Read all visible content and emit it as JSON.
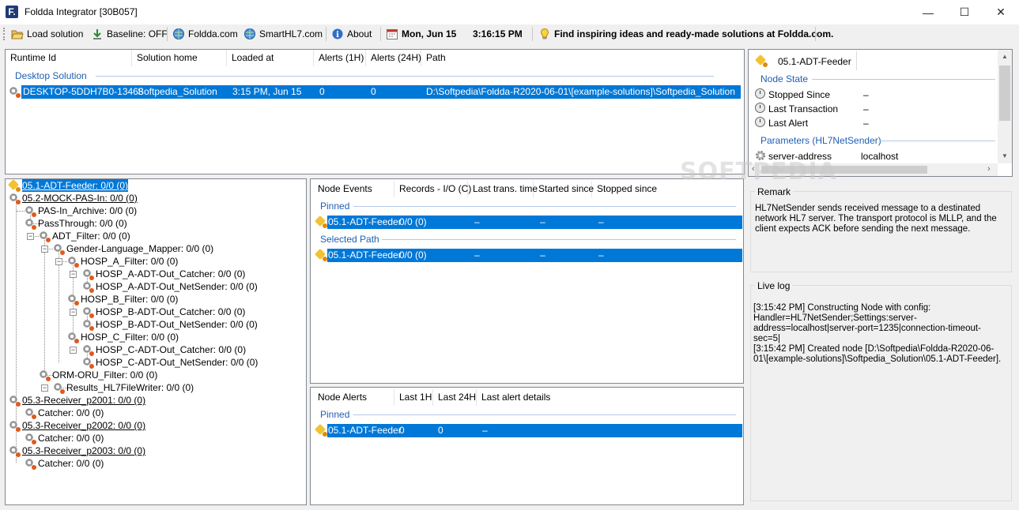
{
  "window": {
    "title": "Foldda Integrator [30B057]",
    "logo_letter": "F.",
    "minimize": "—",
    "maximize": "☐",
    "close": "✕"
  },
  "toolbar": {
    "load_solution": "Load solution",
    "baseline": "Baseline: OFF",
    "foldda": "Foldda.com",
    "smarthl7": "SmartHL7.com",
    "about": "About",
    "date": "Mon, Jun 15",
    "time": "3:16:15 PM",
    "tip": "Find inspiring ideas and ready-made solutions at Foldda.com."
  },
  "runtime_table": {
    "headers": [
      "Runtime Id",
      "Solution home",
      "Loaded at",
      "Alerts (1H)",
      "Alerts (24H)",
      "Path"
    ],
    "group": "Desktop Solution",
    "row": [
      "DESKTOP-5DDH7B0-13468",
      "Softpedia_Solution",
      "3:15 PM, Jun 15",
      "0",
      "0",
      "D:\\Softpedia\\Foldda-R2020-06-01\\[example-solutions]\\Softpedia_Solution"
    ]
  },
  "tree": {
    "nodes": [
      "05.1-ADT-Feeder: 0/0 (0)",
      "05.2-MOCK-PAS-In: 0/0 (0)",
      "PAS-In_Archive: 0/0 (0)",
      "PassThrough: 0/0 (0)",
      "ADT_Filter: 0/0 (0)",
      "Gender-Language_Mapper: 0/0 (0)",
      "HOSP_A_Filter: 0/0 (0)",
      "HOSP_A-ADT-Out_Catcher: 0/0 (0)",
      "HOSP_A-ADT-Out_NetSender: 0/0 (0)",
      "HOSP_B_Filter: 0/0 (0)",
      "HOSP_B-ADT-Out_Catcher: 0/0 (0)",
      "HOSP_B-ADT-Out_NetSender: 0/0 (0)",
      "HOSP_C_Filter: 0/0 (0)",
      "HOSP_C-ADT-Out_Catcher: 0/0 (0)",
      "HOSP_C-ADT-Out_NetSender: 0/0 (0)",
      "ORM-ORU_Filter: 0/0 (0)",
      "Results_HL7FileWriter: 0/0 (0)",
      "05.3-Receiver_p2001: 0/0 (0)",
      "Catcher: 0/0 (0)",
      "05.3-Receiver_p2002: 0/0 (0)",
      "Catcher: 0/0 (0)",
      "05.3-Receiver_p2003: 0/0 (0)",
      "Catcher: 0/0 (0)"
    ]
  },
  "node_events": {
    "headers": [
      "Node Events",
      "Records - I/O (C)",
      "Last trans. time",
      "Started since",
      "Stopped since"
    ],
    "pinned_label": "Pinned",
    "pinned_row": [
      "05.1-ADT-Feeder",
      "0/0 (0)",
      "–",
      "–",
      "–"
    ],
    "selected_label": "Selected Path",
    "selected_row": [
      "05.1-ADT-Feeder",
      "0/0 (0)",
      "–",
      "–",
      "–"
    ]
  },
  "node_alerts": {
    "headers": [
      "Node Alerts",
      "Last 1H",
      "Last 24H",
      "Last alert details"
    ],
    "pinned_label": "Pinned",
    "pinned_row": [
      "05.1-ADT-Feeder",
      "0",
      "0",
      "–"
    ]
  },
  "props": {
    "tab": "05.1-ADT-Feeder",
    "node_state_label": "Node State",
    "stopped_since": "Stopped Since",
    "stopped_since_val": "–",
    "last_transaction": "Last Transaction",
    "last_transaction_val": "–",
    "last_alert": "Last Alert",
    "last_alert_val": "–",
    "params_label": "Parameters (HL7NetSender)",
    "server_address": "server-address",
    "server_address_val": "localhost"
  },
  "remark": {
    "title": "Remark",
    "text": "HL7NetSender sends received message to a destinated network HL7 server. The transport protocol is MLLP, and the client expects ACK before sending the next message."
  },
  "live_log": {
    "title": "Live log",
    "text": "[3:15:42 PM] Constructing Node with config:\nHandler=HL7NetSender;Settings:server-address=localhost|server-port=1235|connection-timeout-sec=5|\n[3:15:42 PM] Created node [D:\\Softpedia\\Foldda-R2020-06-01\\[example-solutions]\\Softpedia_Solution\\05.1-ADT-Feeder]."
  },
  "watermark": "SOFTPEDIA"
}
